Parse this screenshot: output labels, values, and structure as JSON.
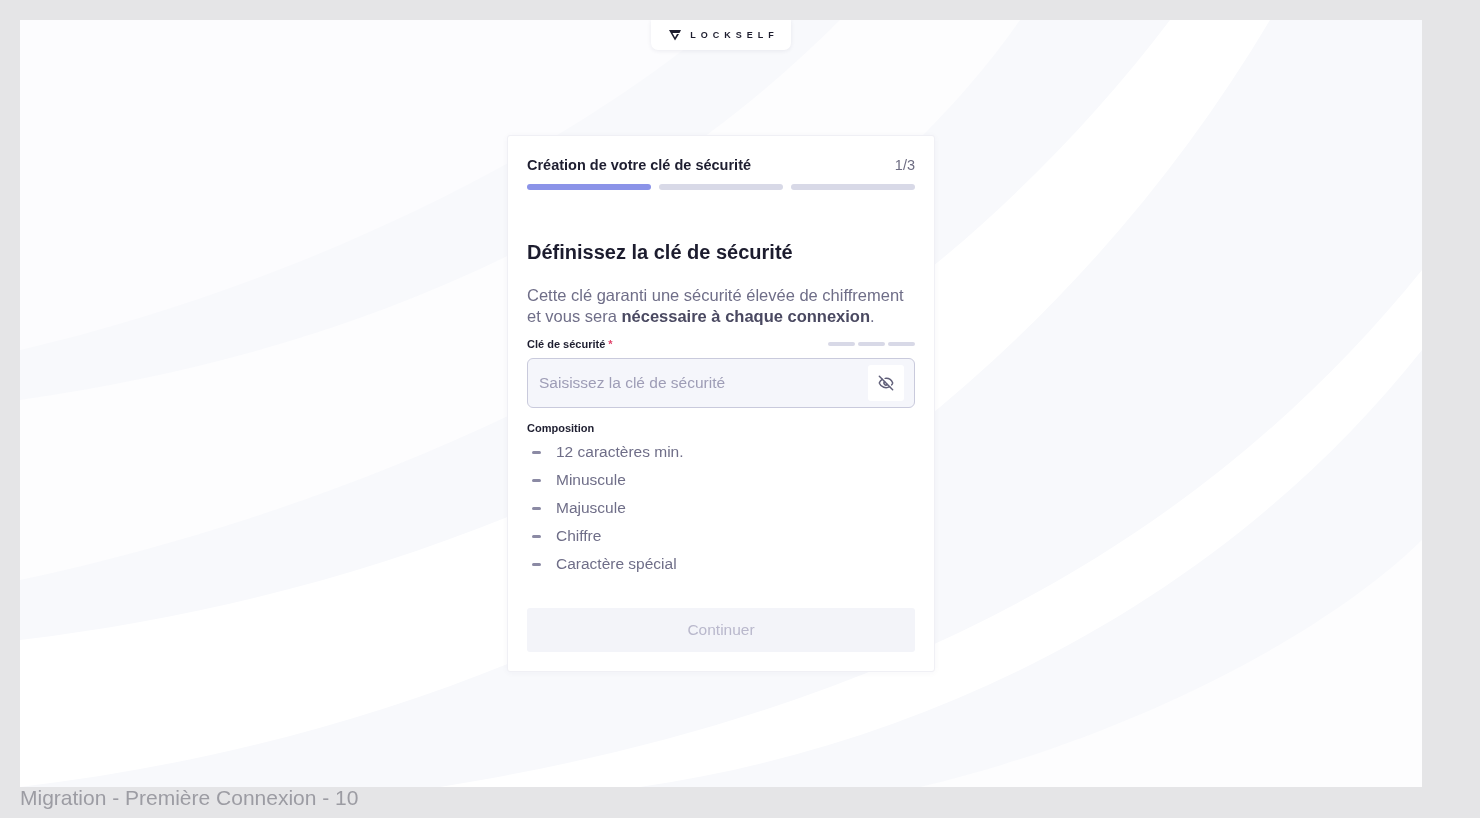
{
  "logo": {
    "text": "LOCKSELF"
  },
  "card": {
    "title": "Création de votre clé de sécurité",
    "step": "1/3",
    "steps": [
      {
        "active": true
      },
      {
        "active": false
      },
      {
        "active": false
      }
    ],
    "heading": "Définissez la clé de sécurité",
    "description": "Cette clé garanti une sécurité élevée de chiffrement et vous sera **nécessaire à chaque connexion**.",
    "field": {
      "label": "Clé de sécurité",
      "required_mark": "*",
      "placeholder": "Saisissez la clé de sécurité",
      "strength": [
        {
          "active": false
        },
        {
          "active": false
        },
        {
          "active": false
        }
      ]
    },
    "composition": {
      "title": "Composition",
      "rules": [
        {
          "text": "12 caractères min.",
          "met": false
        },
        {
          "text": "Minuscule",
          "met": false
        },
        {
          "text": "Majuscule",
          "met": false
        },
        {
          "text": "Chiffre",
          "met": false
        },
        {
          "text": "Caractère spécial",
          "met": false
        }
      ]
    },
    "button": {
      "label": "Continuer",
      "disabled": true
    }
  },
  "frame_label": "Migration - Première Connexion - 10"
}
